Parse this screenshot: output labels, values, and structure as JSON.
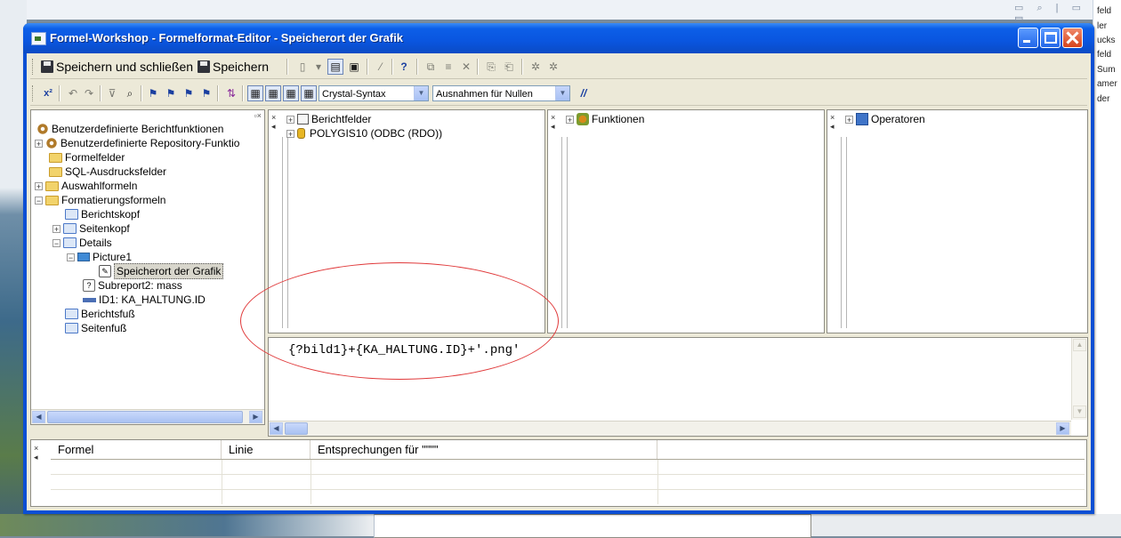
{
  "background": {
    "right_fragments": [
      "feld",
      "ler",
      "ucks",
      "feld",
      "Sum",
      "amer",
      "der"
    ]
  },
  "window": {
    "title": "Formel-Workshop - Formelformat-Editor - Speicherort der Grafik"
  },
  "toolbar1": {
    "save_close_label": "Speichern und schließen",
    "save_label": "Speichern"
  },
  "toolbar2": {
    "syntax_value": "Crystal-Syntax",
    "nulls_value": "Ausnahmen für Nullen",
    "comment_label": "//"
  },
  "tree": {
    "items": [
      {
        "label": "Benutzerdefinierte Berichtfunktionen"
      },
      {
        "label": "Benutzerdefinierte Repository-Funktio"
      },
      {
        "label": "Formelfelder"
      },
      {
        "label": "SQL-Ausdrucksfelder"
      },
      {
        "label": "Auswahlformeln"
      },
      {
        "label": "Formatierungsformeln"
      },
      {
        "label": "Berichtskopf"
      },
      {
        "label": "Seitenkopf"
      },
      {
        "label": "Details"
      },
      {
        "label": "Picture1"
      },
      {
        "label": "Speicherort der Grafik"
      },
      {
        "label": "Subreport2: mass"
      },
      {
        "label": "ID1: KA_HALTUNG.ID"
      },
      {
        "label": "Berichtsfuß"
      },
      {
        "label": "Seitenfuß"
      }
    ]
  },
  "fields_pane": {
    "items": [
      {
        "label": "Berichtfelder"
      },
      {
        "label": "POLYGIS10 (ODBC (RDO))"
      }
    ]
  },
  "functions_pane": {
    "label": "Funktionen"
  },
  "operators_pane": {
    "label": "Operatoren"
  },
  "editor": {
    "code": "{?bild1}+{KA_HALTUNG.ID}+'.png'"
  },
  "errors": {
    "columns": [
      "Formel",
      "Linie",
      "Entsprechungen für \"\"\"\""
    ]
  },
  "colors": {
    "titlebar": "#0a55df",
    "annotation_oval": "#e0393a",
    "client": "#ece9d8"
  }
}
